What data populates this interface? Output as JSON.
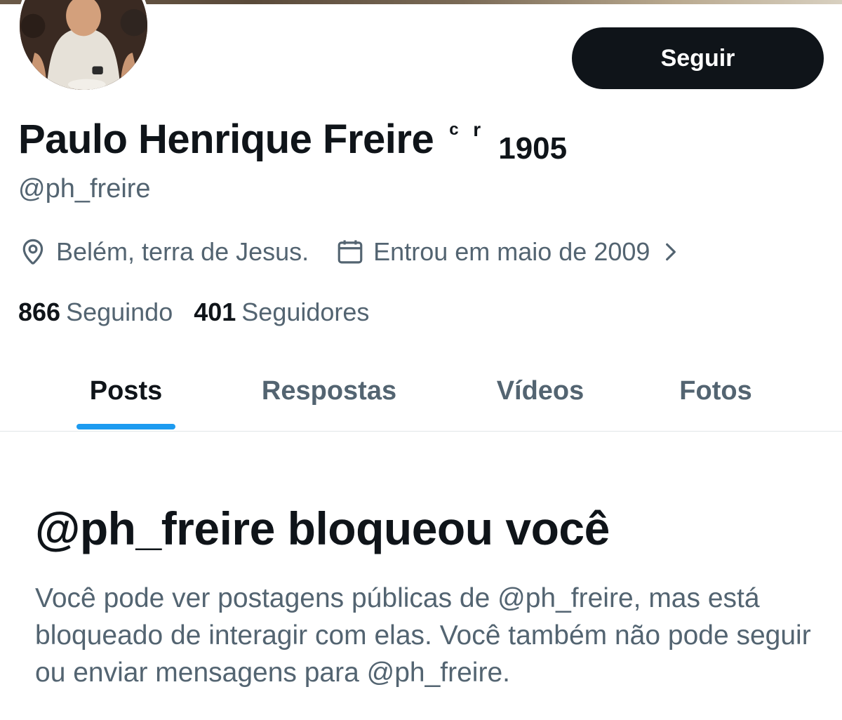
{
  "profile": {
    "display_name": "Paulo Henrique Freire",
    "name_suffix": {
      "c": "c",
      "r": "r",
      "year": "1905"
    },
    "handle": "@ph_freire",
    "location": "Belém, terra de Jesus.",
    "joined": "Entrou em maio de 2009",
    "following_count": "866",
    "following_label": "Seguindo",
    "followers_count": "401",
    "followers_label": "Seguidores"
  },
  "actions": {
    "follow_label": "Seguir"
  },
  "tabs": [
    {
      "label": "Posts",
      "active": true
    },
    {
      "label": "Respostas",
      "active": false
    },
    {
      "label": "Vídeos",
      "active": false
    },
    {
      "label": "Fotos",
      "active": false
    }
  ],
  "blocked_notice": {
    "title": "@ph_freire bloqueou você",
    "description": "Você pode ver postagens públicas de @ph_freire, mas está bloqueado de interagir com elas. Você também não pode seguir ou enviar mensagens para @ph_freire."
  },
  "icons": {
    "location": "location-pin-icon",
    "calendar": "calendar-icon",
    "chevron": "chevron-right-icon"
  },
  "colors": {
    "text_primary": "#0f1419",
    "text_secondary": "#536471",
    "accent": "#1d9bf0",
    "button_bg": "#0f1419"
  }
}
